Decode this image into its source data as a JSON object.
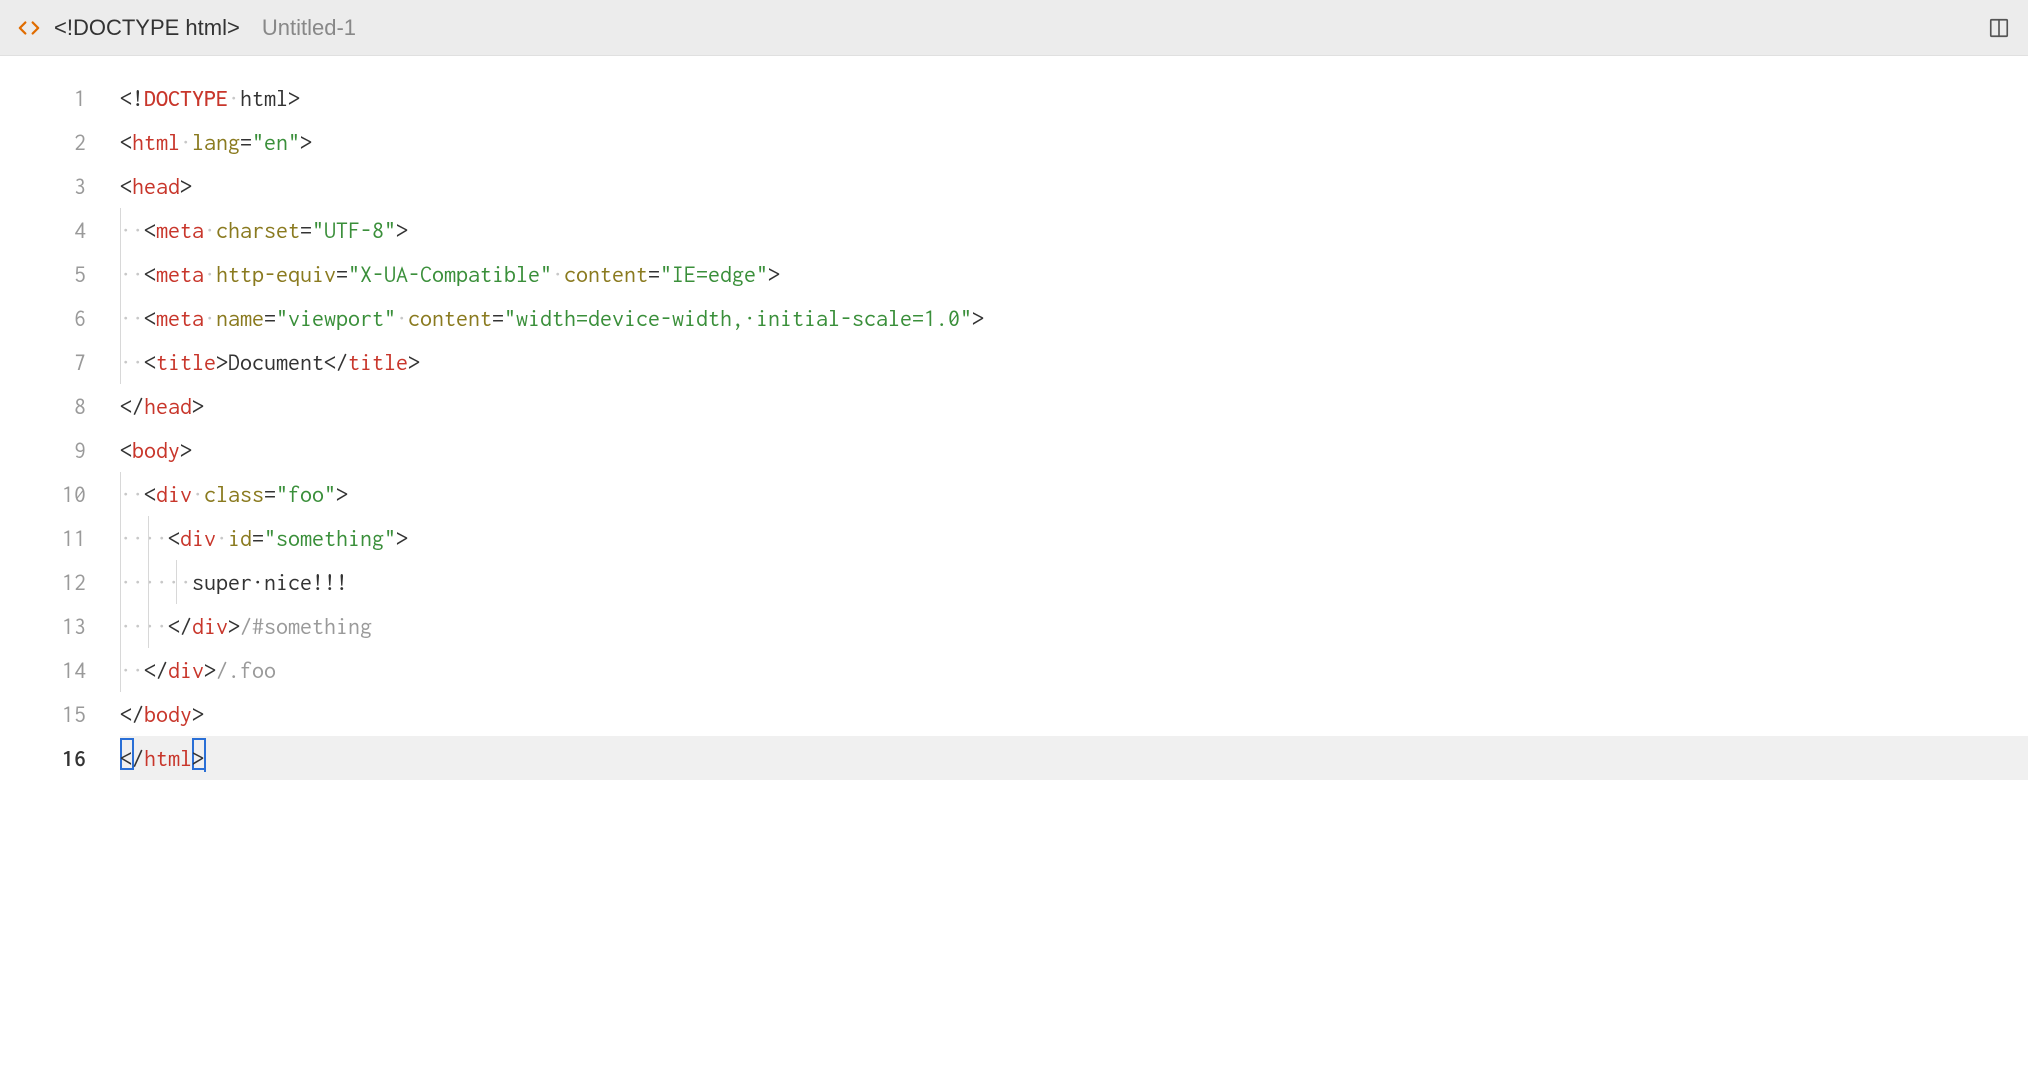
{
  "titlebar": {
    "doctype_label": "<!DOCTYPE html>",
    "filename": "Untitled-1"
  },
  "line_numbers": [
    "1",
    "2",
    "3",
    "4",
    "5",
    "6",
    "7",
    "8",
    "9",
    "10",
    "11",
    "12",
    "13",
    "14",
    "15",
    "16"
  ],
  "active_line": 16,
  "code": {
    "l1": {
      "p1": "<!",
      "doctype": "DOCTYPE",
      "sp": "·",
      "html": "html",
      "p2": ">"
    },
    "l2": {
      "p1": "<",
      "tag": "html",
      "sp": "·",
      "attr": "lang",
      "eq": "=",
      "val": "\"en\"",
      "p2": ">"
    },
    "l3": {
      "p1": "<",
      "tag": "head",
      "p2": ">"
    },
    "l4": {
      "indent": "··",
      "p1": "<",
      "tag": "meta",
      "sp": "·",
      "attr": "charset",
      "eq": "=",
      "val": "\"UTF-8\"",
      "p2": ">"
    },
    "l5": {
      "indent": "··",
      "p1": "<",
      "tag": "meta",
      "sp": "·",
      "attr1": "http-equiv",
      "eq": "=",
      "val1": "\"X-UA-Compatible\"",
      "sp2": "·",
      "attr2": "content",
      "val2": "\"IE=edge\"",
      "p2": ">"
    },
    "l6": {
      "indent": "··",
      "p1": "<",
      "tag": "meta",
      "sp": "·",
      "attr1": "name",
      "eq": "=",
      "val1": "\"viewport\"",
      "sp2": "·",
      "attr2": "content",
      "val2": "\"width=device-width,·initial-scale=1.0\"",
      "p2": ">"
    },
    "l7": {
      "indent": "··",
      "p1": "<",
      "tag": "title",
      "p2": ">",
      "txt": "Document",
      "p3": "</",
      "p4": ">"
    },
    "l8": {
      "p1": "</",
      "tag": "head",
      "p2": ">"
    },
    "l9": {
      "p1": "<",
      "tag": "body",
      "p2": ">"
    },
    "l10": {
      "indent": "··",
      "p1": "<",
      "tag": "div",
      "sp": "·",
      "attr": "class",
      "eq": "=",
      "val": "\"foo\"",
      "p2": ">"
    },
    "l11": {
      "indent": "····",
      "p1": "<",
      "tag": "div",
      "sp": "·",
      "attr": "id",
      "eq": "=",
      "val": "\"something\"",
      "p2": ">"
    },
    "l12": {
      "indent": "······",
      "txt": "super·nice!!!"
    },
    "l13": {
      "indent": "····",
      "p1": "</",
      "tag": "div",
      "p2": ">",
      "cmt": "/#something"
    },
    "l14": {
      "indent": "··",
      "p1": "</",
      "tag": "div",
      "p2": ">",
      "cmt": "/.foo"
    },
    "l15": {
      "p1": "</",
      "tag": "body",
      "p2": ">"
    },
    "l16": {
      "p1": "</",
      "tag": "html",
      "p2": ">"
    }
  }
}
